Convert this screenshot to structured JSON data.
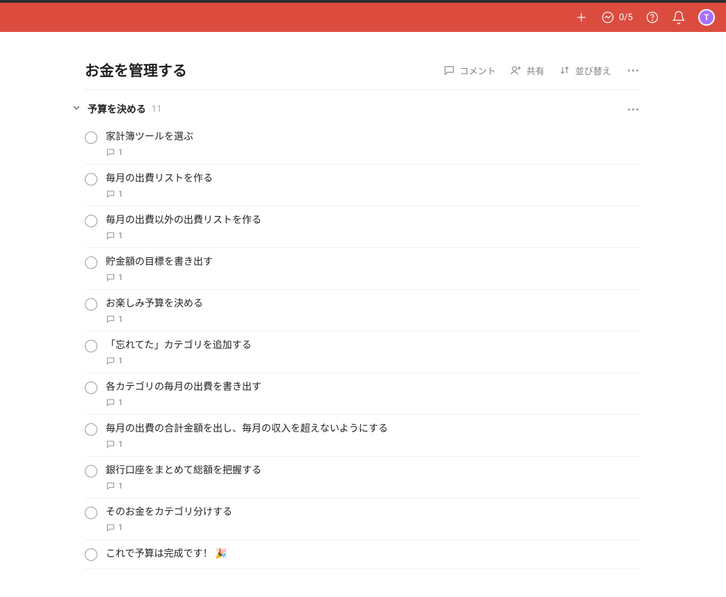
{
  "topbar": {
    "progress": "0/5",
    "avatar_letter": "T"
  },
  "header": {
    "title": "お金を管理する",
    "comments_label": "コメント",
    "share_label": "共有",
    "sort_label": "並び替え"
  },
  "section": {
    "title": "予算を決める",
    "count": "11"
  },
  "tasks": [
    {
      "title": "家計簿ツールを選ぶ",
      "comments": "1"
    },
    {
      "title": "毎月の出費リストを作る",
      "comments": "1"
    },
    {
      "title": "毎月の出費以外の出費リストを作る",
      "comments": "1"
    },
    {
      "title": "貯金額の目標を書き出す",
      "comments": "1"
    },
    {
      "title": "お楽しみ予算を決める",
      "comments": "1"
    },
    {
      "title": "「忘れてた」カテゴリを追加する",
      "comments": "1"
    },
    {
      "title": "各カテゴリの毎月の出費を書き出す",
      "comments": "1"
    },
    {
      "title": "毎月の出費の合計金額を出し、毎月の収入を超えないようにする",
      "comments": "1"
    },
    {
      "title": "銀行口座をまとめて総額を把握する",
      "comments": "1"
    },
    {
      "title": "そのお金をカテゴリ分けする",
      "comments": "1"
    },
    {
      "title": "これで予算は完成です！ 🎉",
      "comments": null
    }
  ]
}
